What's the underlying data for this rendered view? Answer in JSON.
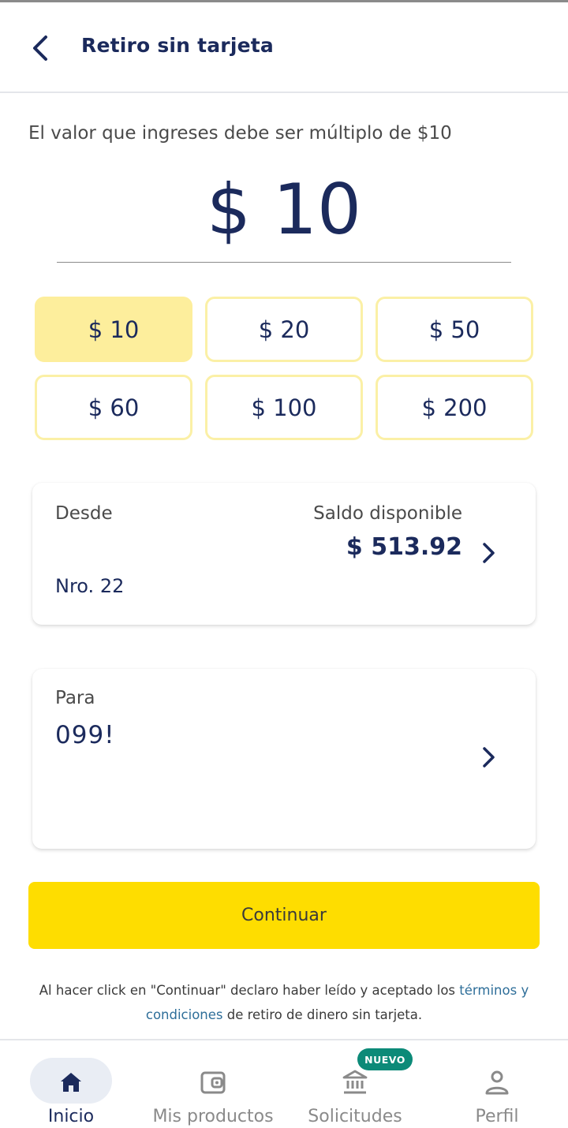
{
  "header": {
    "title": "Retiro sin tarjeta"
  },
  "amount_input": {
    "hint": "El valor que ingreses debe ser múltiplo de $10",
    "value": "$ 10"
  },
  "quick_amounts": [
    {
      "label": "$ 10",
      "selected": true
    },
    {
      "label": "$ 20",
      "selected": false
    },
    {
      "label": "$ 50",
      "selected": false
    },
    {
      "label": "$ 60",
      "selected": false
    },
    {
      "label": "$ 100",
      "selected": false
    },
    {
      "label": "$ 200",
      "selected": false
    }
  ],
  "from_card": {
    "label": "Desde",
    "balance_label": "Saldo disponible",
    "balance_value": "$ 513.92",
    "account": "Nro. 22"
  },
  "to_card": {
    "label": "Para",
    "value": "099!"
  },
  "continue_button": {
    "label": "Continuar"
  },
  "legal": {
    "text_before": "Al hacer click en \"Continuar\" declaro haber leído y aceptado los ",
    "link": "términos y condiciones",
    "text_after": " de retiro de dinero sin tarjeta."
  },
  "tabbar": {
    "items": [
      {
        "label": "Inicio",
        "icon": "home-icon",
        "active": true
      },
      {
        "label": "Mis productos",
        "icon": "wallet-icon",
        "active": false
      },
      {
        "label": "Solicitudes",
        "icon": "bank-icon",
        "active": false,
        "badge": "NUEVO"
      },
      {
        "label": "Perfil",
        "icon": "user-icon",
        "active": false
      }
    ]
  },
  "colors": {
    "primary_text": "#1b2a5c",
    "accent_yellow": "#fedd00",
    "chip_selected": "#fdee9c",
    "chip_border": "#fbf0a6",
    "badge_green": "#0c8a78",
    "link_blue": "#2e6e99"
  }
}
